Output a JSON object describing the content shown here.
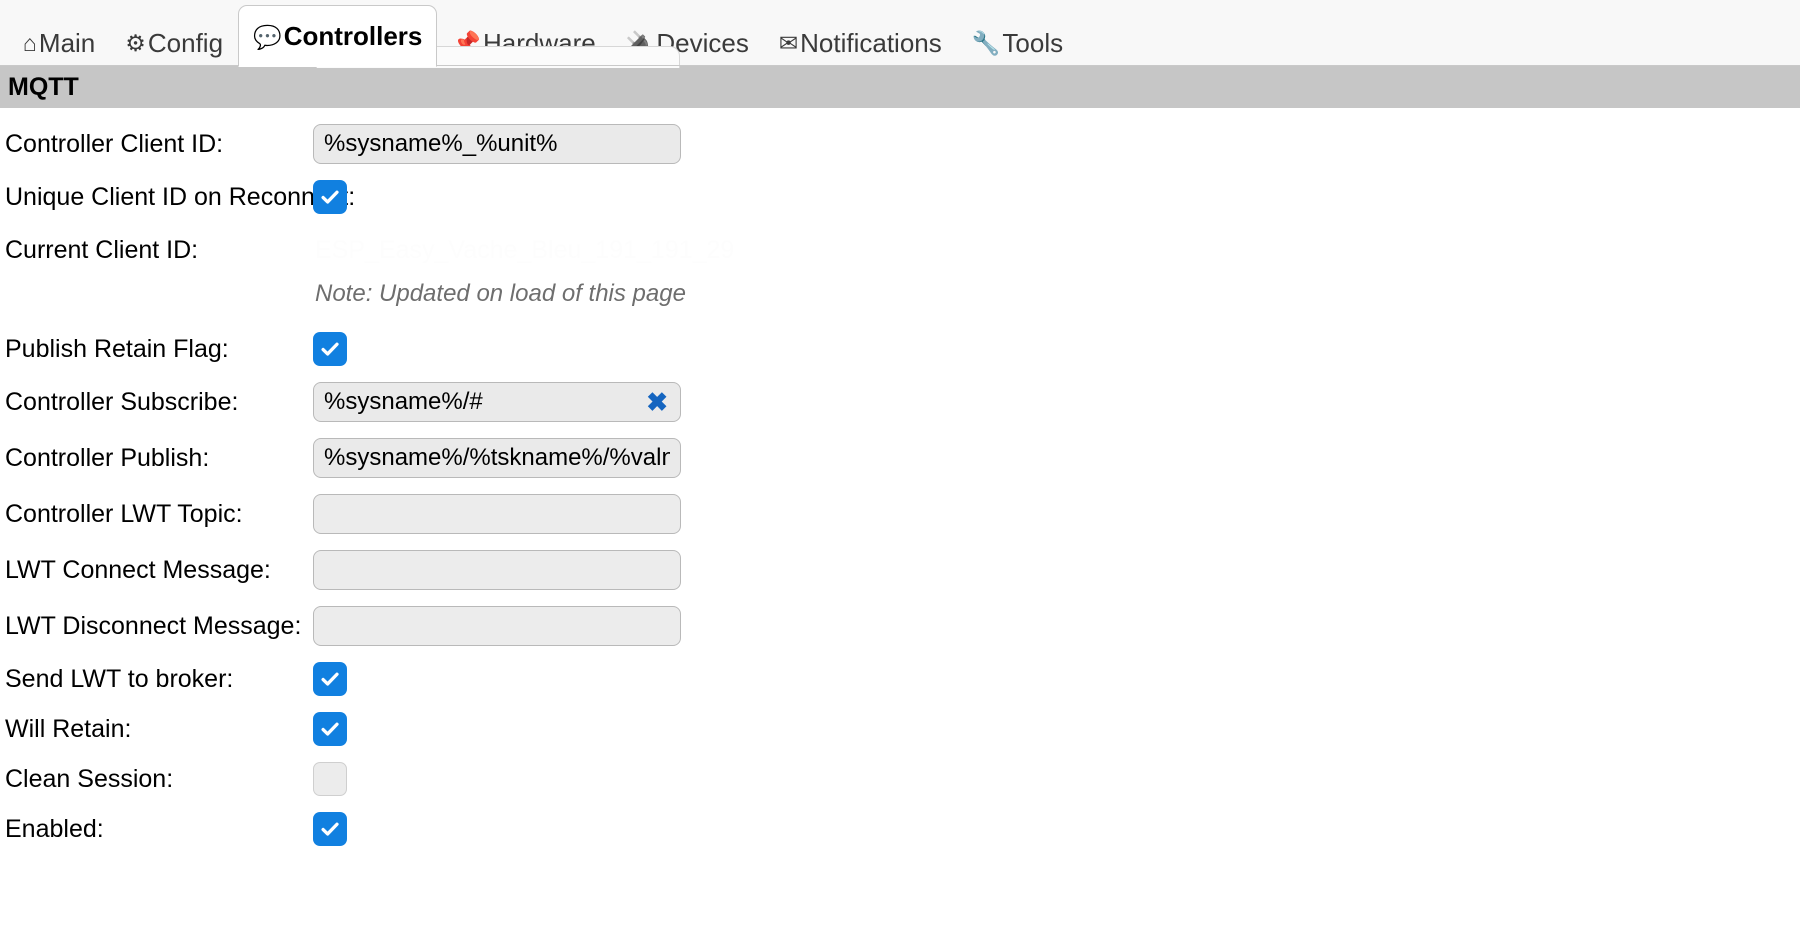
{
  "nav": {
    "tabs": [
      {
        "icon": "home-icon",
        "glyph": "⌂",
        "label": "Main",
        "active": false
      },
      {
        "icon": "gear-icon",
        "glyph": "⚙",
        "label": "Config",
        "active": false
      },
      {
        "icon": "speech-balloon-icon",
        "glyph": "💬",
        "label": "Controllers",
        "active": true
      },
      {
        "icon": "pushpin-icon",
        "glyph": "📌",
        "label": "Hardware",
        "active": false
      },
      {
        "icon": "electric-plug-icon",
        "glyph": "🔌",
        "label": "Devices",
        "active": false
      },
      {
        "icon": "envelope-icon",
        "glyph": "✉",
        "label": "Notifications",
        "active": false
      },
      {
        "icon": "wrench-icon",
        "glyph": "🔧",
        "label": "Tools",
        "active": false
      }
    ]
  },
  "section": {
    "title": "MQTT"
  },
  "form": {
    "rows": [
      {
        "name": "controller-client-id",
        "label": "Controller Client ID:",
        "type": "text",
        "value": "%sysname%_%unit%",
        "clearable": false
      },
      {
        "name": "unique-client-id-on-reconnect",
        "label": "Unique Client ID on Reconnect:",
        "type": "checkbox",
        "checked": true
      },
      {
        "name": "current-client-id",
        "label": "Current Client ID:",
        "type": "faint-text",
        "value": "ESP_Easy_Vache_Bleu_191_191_29"
      },
      {
        "name": "current-client-id-note",
        "label": "",
        "type": "note",
        "value": "Note: Updated on load of this page"
      },
      {
        "name": "publish-retain-flag",
        "label": "Publish Retain Flag:",
        "type": "checkbox",
        "checked": true
      },
      {
        "name": "controller-subscribe",
        "label": "Controller Subscribe:",
        "type": "text",
        "value": "%sysname%/#",
        "clearable": true,
        "clear_glyph": "✖"
      },
      {
        "name": "controller-publish",
        "label": "Controller Publish:",
        "type": "text",
        "value": "%sysname%/%tskname%/%valname%",
        "clearable": false
      },
      {
        "name": "controller-lwt-topic",
        "label": "Controller LWT Topic:",
        "type": "text",
        "value": "",
        "clearable": false
      },
      {
        "name": "lwt-connect-message",
        "label": "LWT Connect Message:",
        "type": "text",
        "value": "",
        "clearable": false
      },
      {
        "name": "lwt-disconnect-message",
        "label": "LWT Disconnect Message:",
        "type": "text",
        "value": "",
        "clearable": false
      },
      {
        "name": "send-lwt-to-broker",
        "label": "Send LWT to broker:",
        "type": "checkbox",
        "checked": true
      },
      {
        "name": "will-retain",
        "label": "Will Retain:",
        "type": "checkbox",
        "checked": true
      },
      {
        "name": "clean-session",
        "label": "Clean Session:",
        "type": "checkbox",
        "checked": false
      },
      {
        "name": "enabled",
        "label": "Enabled:",
        "type": "checkbox",
        "checked": true
      }
    ]
  },
  "colors": {
    "checkbox_on": "#1180e0",
    "section_bar": "#c6c6c6",
    "clear_icon": "#1565c0"
  }
}
